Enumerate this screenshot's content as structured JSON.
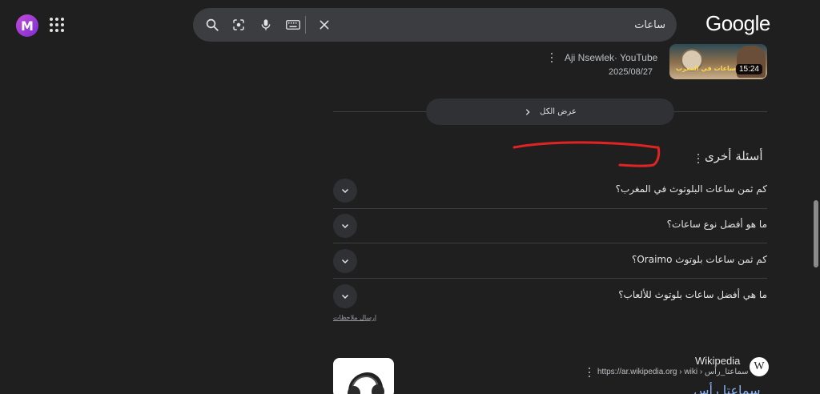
{
  "header": {
    "avatar_letter": "M",
    "logo": "Google",
    "search": {
      "query": "ساعات"
    }
  },
  "video": {
    "source": "Aji Nsewlek· YouTube",
    "date": "2025/08/27",
    "duration": "15:24",
    "thumb_text": "أفضل ساعات في المغرب"
  },
  "see_all": "عرض الكل",
  "paa": {
    "title": "أسئلة أخرى",
    "questions": [
      "كم ثمن ساعات البلوتوث في المغرب؟",
      "ما هو أفضل نوع ساعات؟",
      "كم ثمن ساعات بلوتوث Oraimo؟",
      "ما هي أفضل ساعات بلوتوث للألعاب؟"
    ]
  },
  "feedback": "إرسال ملاحظات",
  "wiki": {
    "favicon": "W",
    "name": "Wikipedia",
    "url": "https://ar.wikipedia.org › wiki › سماعتا_رأس",
    "title": "سماعتا رأس"
  },
  "colors": {
    "accent_arrow": "#e02424",
    "link": "#8ab4f8"
  }
}
